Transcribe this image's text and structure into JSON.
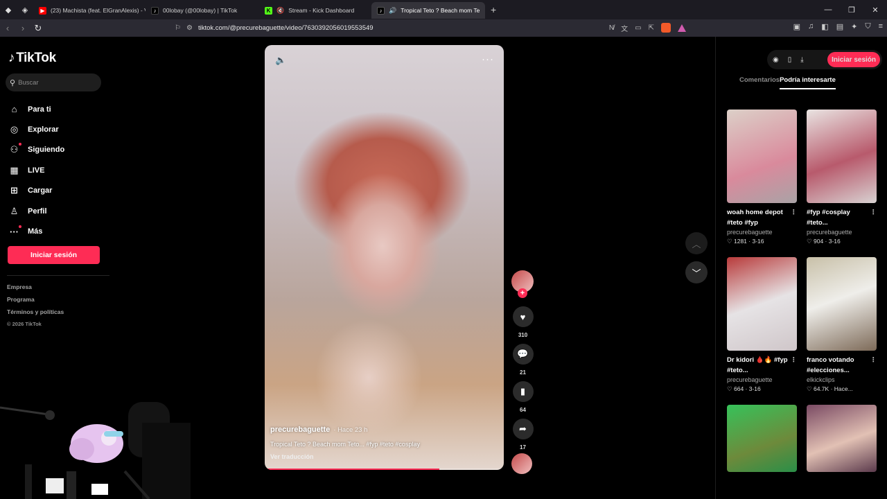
{
  "browser": {
    "tabs": [
      {
        "title": "(23) Machista (feat. ElGranAlexis) - V",
        "favicon": "youtube-icon",
        "color": "#ff0000",
        "active": false
      },
      {
        "title": "00lobay (@00lobay) | TikTok",
        "favicon": "tiktok-icon",
        "color": "#000000",
        "active": false
      },
      {
        "title": "Stream - Kick Dashboard",
        "favicon": "kick-icon",
        "color": "#53fc18",
        "active": false
      },
      {
        "title": "Tropical Teto ? Beach mom Te",
        "favicon": "tiktok-icon",
        "color": "#000000",
        "active": true
      }
    ],
    "url": "tiktok.com/@precurebaguette/video/7630392056019553549"
  },
  "sidebar": {
    "logo": "TikTok",
    "search_placeholder": "Buscar",
    "menu": [
      {
        "label": "Para ti",
        "icon": "home-icon"
      },
      {
        "label": "Explorar",
        "icon": "compass-icon"
      },
      {
        "label": "Siguiendo",
        "icon": "following-icon"
      },
      {
        "label": "LIVE",
        "icon": "live-icon"
      },
      {
        "label": "Cargar",
        "icon": "upload-icon"
      },
      {
        "label": "Perfil",
        "icon": "profile-icon"
      },
      {
        "label": "Más",
        "icon": "more-icon"
      }
    ],
    "login_label": "Iniciar sesión",
    "footer": [
      "Empresa",
      "Programa",
      "Términos y políticas"
    ],
    "copyright": "© 2026 TikTok"
  },
  "video": {
    "author": "precurebaguette",
    "time": "· Hace 23 h",
    "caption": "Tropical Teto ? Beach mom Teto... #fyp #teto #cosplay",
    "translate": "Ver traducción",
    "progress": 0.73,
    "likes": "310",
    "comments": "21",
    "saves": "64",
    "shares": "17"
  },
  "right": {
    "login_label": "Iniciar sesión",
    "tabs": [
      "Comentarios",
      "Podría interesarte"
    ],
    "cards": [
      {
        "title": "woah home depot #teto #fyp",
        "author": "precurebaguette",
        "likes": "1281",
        "date": "3-16",
        "c1": "#dcd0c8",
        "c2": "#d98a9c"
      },
      {
        "title": "#fyp #cosplay #teto...",
        "author": "precurebaguette",
        "likes": "904",
        "date": "3-16",
        "c1": "#e9e4e2",
        "c2": "#b85a6c"
      },
      {
        "title": "Dr kidori 🩸🔥 #fyp #teto...",
        "author": "precurebaguette",
        "likes": "664",
        "date": "3-16",
        "c1": "#e6e3e5",
        "c2": "#b83a3a"
      },
      {
        "title": "franco votando #elecciones...",
        "author": "elkickclips",
        "likes": "64.7K",
        "date": "Hace...",
        "c1": "#c8c0a8",
        "c2": "#7d6a58"
      },
      {
        "title": "",
        "author": "",
        "likes": "",
        "date": "",
        "c1": "#36c25a",
        "c2": "#6d8a3b"
      },
      {
        "title": "",
        "author": "",
        "likes": "",
        "date": "",
        "c1": "#7a4a63",
        "c2": "#e2c1b4"
      }
    ]
  }
}
